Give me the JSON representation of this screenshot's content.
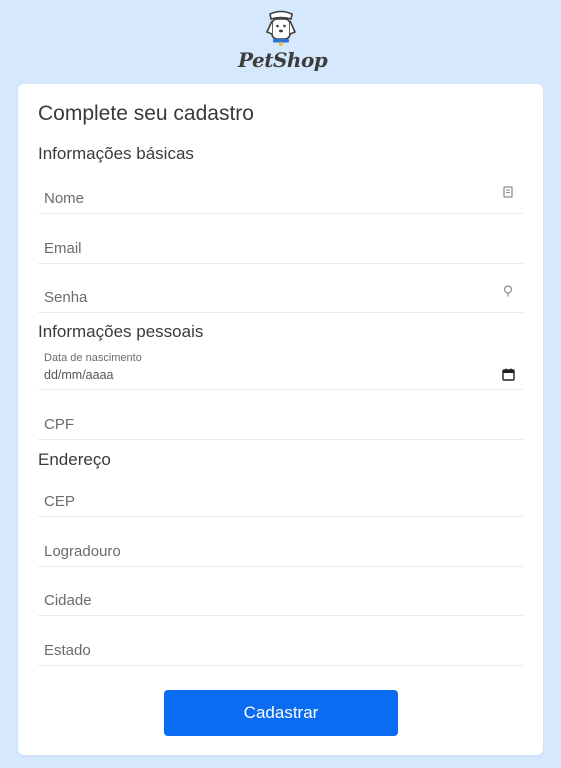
{
  "brand": {
    "name": "PetShop",
    "icon": "dog-mascot-icon",
    "accent": "#0a6cf0",
    "background": "#d6e8fd"
  },
  "form": {
    "title": "Complete seu cadastro",
    "sections": {
      "basic": "Informações básicas",
      "personal": "Informações pessoais",
      "address": "Endereço"
    },
    "fields": {
      "nome": {
        "placeholder": "Nome",
        "icon": "id-card-icon"
      },
      "email": {
        "placeholder": "Email"
      },
      "senha": {
        "placeholder": "Senha",
        "icon": "key-icon"
      },
      "data_nascimento": {
        "label": "Data de nascimento",
        "placeholder": "dd/mm/aaaa",
        "icon": "calendar-icon"
      },
      "cpf": {
        "placeholder": "CPF"
      },
      "cep": {
        "placeholder": "CEP"
      },
      "logradouro": {
        "placeholder": "Logradouro"
      },
      "cidade": {
        "placeholder": "Cidade"
      },
      "estado": {
        "placeholder": "Estado"
      }
    },
    "submit_label": "Cadastrar"
  }
}
